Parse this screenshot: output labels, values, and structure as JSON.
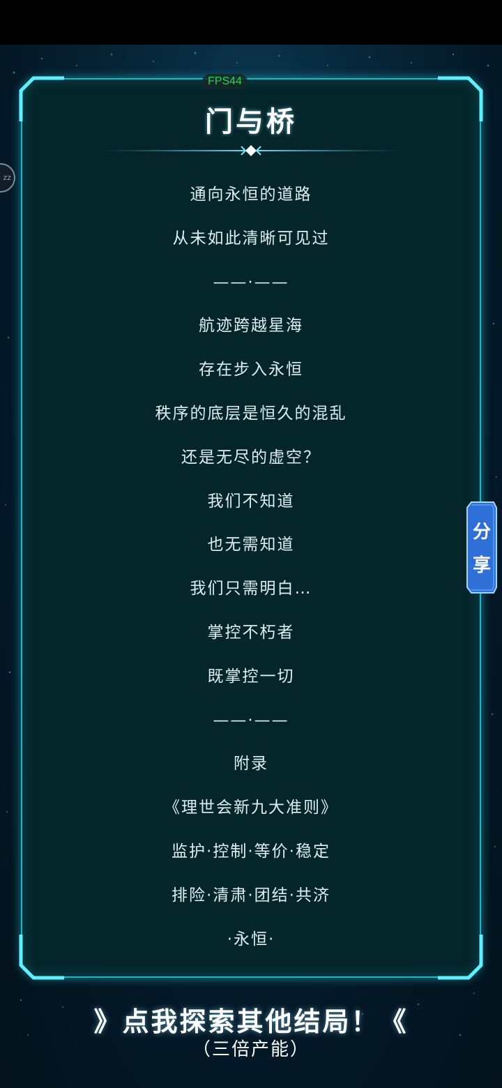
{
  "app": {
    "fps_label": "FPS44",
    "left_badge": "zz"
  },
  "story": {
    "title": "门与桥",
    "lines": [
      "通向永恒的道路",
      "从未如此清晰可见过",
      "——·——",
      "航迹跨越星海",
      "存在步入永恒",
      "秩序的底层是恒久的混乱",
      "还是无尽的虚空？",
      "我们不知道",
      "也无需知道",
      "我们只需明白…",
      "掌控不朽者",
      "既掌控一切",
      "——·——",
      "附录",
      "《理世会新九大准则》",
      "监护·控制·等价·稳定",
      "排险·清肃·团结·共济",
      "·永恒·"
    ]
  },
  "share_tab": {
    "line1": "分",
    "line2": "享"
  },
  "footer": {
    "explore_label": "》点我探索其他结局！《",
    "explore_sub": "（三倍产能）"
  },
  "colors": {
    "panel_border": "#1fb6c8",
    "panel_bg": "#04252a",
    "text": "#dfeef4",
    "fps": "#2fd24a",
    "share_tab": "#2f6fd8"
  }
}
